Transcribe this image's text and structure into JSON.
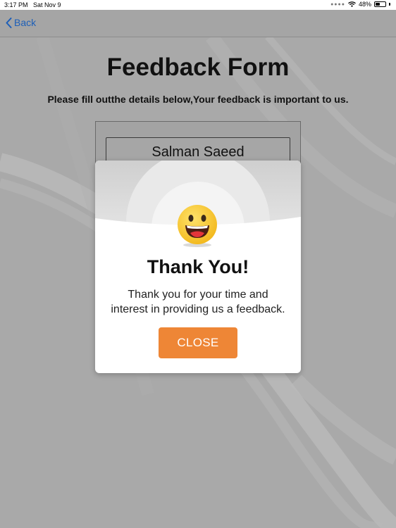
{
  "status_bar": {
    "time": "3:17 PM",
    "date": "Sat Nov 9",
    "battery": "48%",
    "battery_level": 0.48,
    "wifi_icon": "wifi-icon",
    "battery_icon": "battery-icon"
  },
  "nav": {
    "back_label": "Back",
    "back_icon": "chevron-left-icon"
  },
  "form": {
    "title": "Feedback Form",
    "subtitle": "Please fill outthe details below,Your feedback is important to us.",
    "name_value": "Salman Saeed"
  },
  "modal": {
    "icon": "smiley-face-icon",
    "title": "Thank You!",
    "message_line1": "Thank you for your time and",
    "message_line2": "interest in providing us a feedback.",
    "close_label": "CLOSE"
  },
  "colors": {
    "accent_button": "#ee8636",
    "link": "#1d5fb8",
    "overlay_background": "#a9a9a9"
  }
}
